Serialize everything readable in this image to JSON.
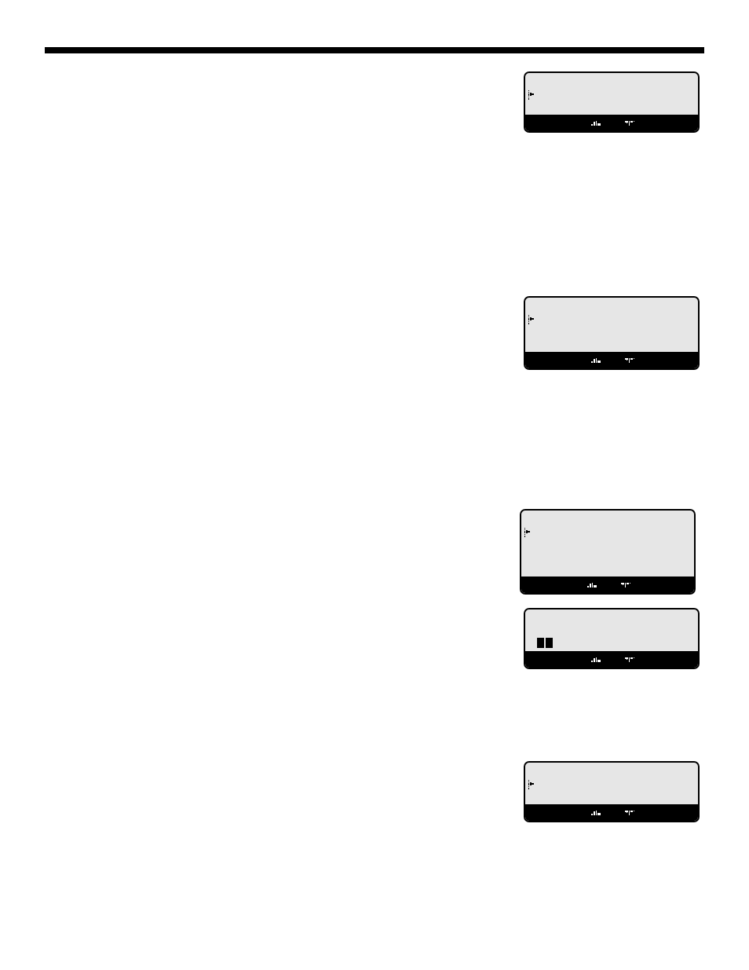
{
  "screens": [
    {
      "kind": "pointer"
    },
    {
      "kind": "pointer"
    },
    {
      "kind": "pointer"
    },
    {
      "kind": "blocks"
    },
    {
      "kind": "pointer"
    }
  ]
}
